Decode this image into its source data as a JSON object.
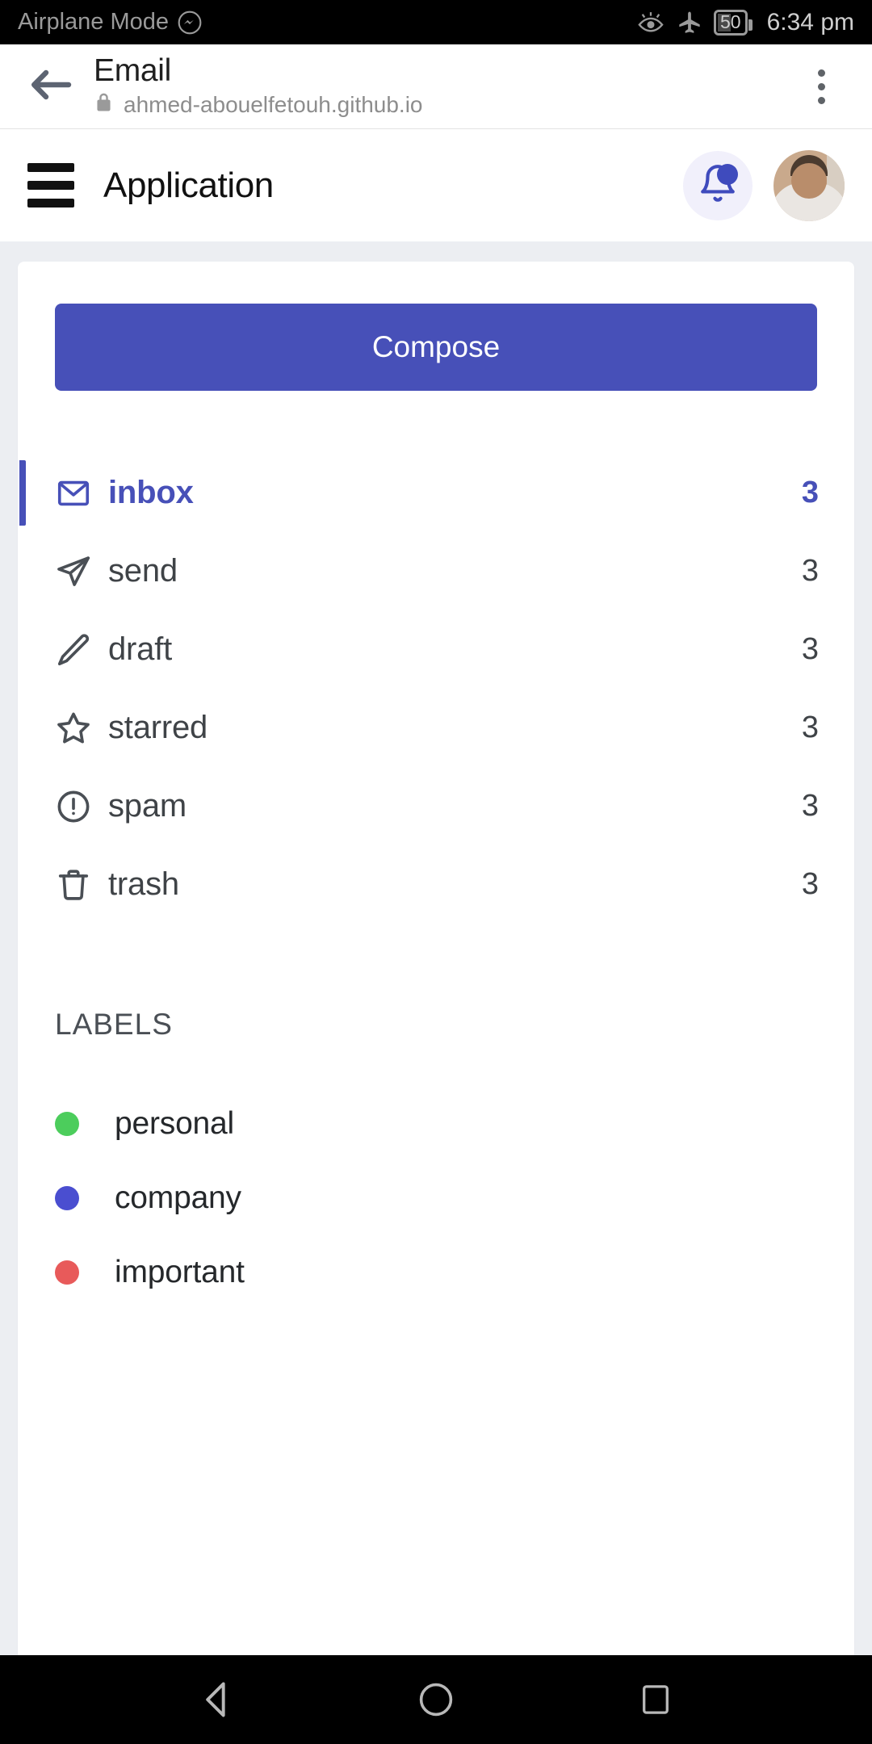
{
  "status_bar": {
    "left_text": "Airplane Mode",
    "messenger_icon": "messenger-icon",
    "eye_icon": "eye-icon",
    "airplane_icon": "airplane-icon",
    "battery_level": "50",
    "clock": "6:34 pm"
  },
  "browser": {
    "back_icon": "back-arrow-icon",
    "title": "Email",
    "lock_icon": "lock-icon",
    "url": "ahmed-abouelfetouh.github.io",
    "overflow_icon": "overflow-menu-icon"
  },
  "app_bar": {
    "menu_icon": "hamburger-menu-icon",
    "title": "Application",
    "bell_icon": "notification-bell-icon",
    "avatar": "user-avatar"
  },
  "sidebar": {
    "compose_label": "Compose",
    "folders": [
      {
        "id": "inbox",
        "label": "inbox",
        "count": "3",
        "icon": "mail-icon",
        "active": true
      },
      {
        "id": "send",
        "label": "send",
        "count": "3",
        "icon": "send-icon",
        "active": false
      },
      {
        "id": "draft",
        "label": "draft",
        "count": "3",
        "icon": "pencil-icon",
        "active": false
      },
      {
        "id": "starred",
        "label": "starred",
        "count": "3",
        "icon": "star-icon",
        "active": false
      },
      {
        "id": "spam",
        "label": "spam",
        "count": "3",
        "icon": "alert-circle-icon",
        "active": false
      },
      {
        "id": "trash",
        "label": "trash",
        "count": "3",
        "icon": "trash-icon",
        "active": false
      }
    ],
    "labels_heading": "LABELS",
    "labels": [
      {
        "id": "personal",
        "label": "personal",
        "color": "#4ccd5c"
      },
      {
        "id": "company",
        "label": "company",
        "color": "#4a4ed0"
      },
      {
        "id": "important",
        "label": "important",
        "color": "#e85a5a"
      }
    ]
  },
  "nav_bar": {
    "back_icon": "android-back-icon",
    "home_icon": "android-home-icon",
    "recents_icon": "android-recents-icon"
  },
  "colors": {
    "accent": "#4750b8",
    "page_bg": "#eceef2",
    "card_bg": "#ffffff",
    "text": "#3f4347"
  }
}
